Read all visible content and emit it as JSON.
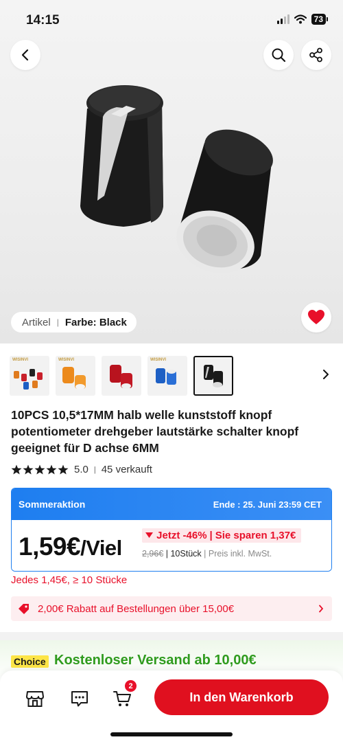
{
  "status_bar": {
    "time": "14:15",
    "battery": "73"
  },
  "gallery": {
    "article_label": "Artikel",
    "color_label": "Farbe: Black",
    "thumbnails": [
      {
        "brand": "WISINVI",
        "color": "multi"
      },
      {
        "brand": "WISINVI",
        "color": "orange"
      },
      {
        "brand": "",
        "color": "red"
      },
      {
        "brand": "WISINVI",
        "color": "blue"
      },
      {
        "brand": "",
        "color": "black",
        "selected": true
      }
    ]
  },
  "product": {
    "title": "10PCS 10,5*17MM halb welle kunststoff knopf potentiometer drehgeber lautstärke schalter knopf geeignet für D achse 6MM",
    "rating": "5.0",
    "sold": "45 verkauft"
  },
  "promo": {
    "name": "Sommeraktion",
    "end": "Ende : 25. Juni 23:59 CET",
    "price": "1,59€",
    "price_unit": "/Viel",
    "discount": "Jetzt -46%",
    "savings": "Sie sparen 1,37€",
    "old_price": "2,96€",
    "pack": "10Stück",
    "tax_note": "Preis inkl. MwSt."
  },
  "bulk_price": "Jedes 1,45€, ≥ 10 Stücke",
  "coupon": "2,00€ Rabatt auf Bestellungen über 15,00€",
  "shipping": {
    "badge": "Choice",
    "text": "Kostenloser Versand ab 10,00€"
  },
  "bottom_bar": {
    "cart_count": "2",
    "add_to_cart": "In den Warenkorb"
  },
  "colors": {
    "accent_red": "#e0101f",
    "promo_blue": "#1e7ef0",
    "shipping_green": "#2f9b1e"
  }
}
